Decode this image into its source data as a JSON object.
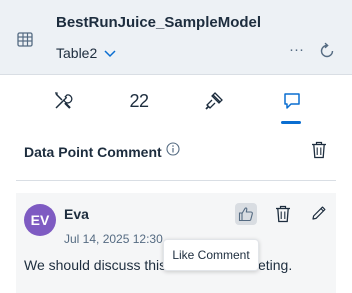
{
  "header": {
    "model_name": "BestRunJuice_SampleModel",
    "table_name": "Table2",
    "more_label": "···",
    "icons": {
      "left": "table-grid-icon",
      "chevron": "chevron-down-icon",
      "more": "more-options-icon",
      "refresh": "refresh-icon"
    }
  },
  "tabs": [
    {
      "icon": "tools-icon",
      "selected": false
    },
    {
      "label": "22",
      "selected": false
    },
    {
      "icon": "paint-brush-icon",
      "selected": false
    },
    {
      "icon": "comment-icon",
      "selected": true
    }
  ],
  "section": {
    "title": "Data Point Comment",
    "info_icon": "info-icon",
    "delete_icon": "trash-icon"
  },
  "comment": {
    "avatar_initials": "EV",
    "author": "Eva",
    "timestamp": "Jul 14, 2025 12:30",
    "text": "We should discuss this in the next meeting.",
    "actions": [
      "like-icon",
      "trash-icon",
      "edit-icon"
    ]
  },
  "tooltip": {
    "text": "Like Comment"
  },
  "colors": {
    "header_bg": "#edf1f5",
    "accent": "#0a6ed1",
    "avatar_bg": "#7e5bc2",
    "card_bg": "#f5f6f7",
    "text": "#1d2d3e",
    "muted": "#556b82"
  }
}
